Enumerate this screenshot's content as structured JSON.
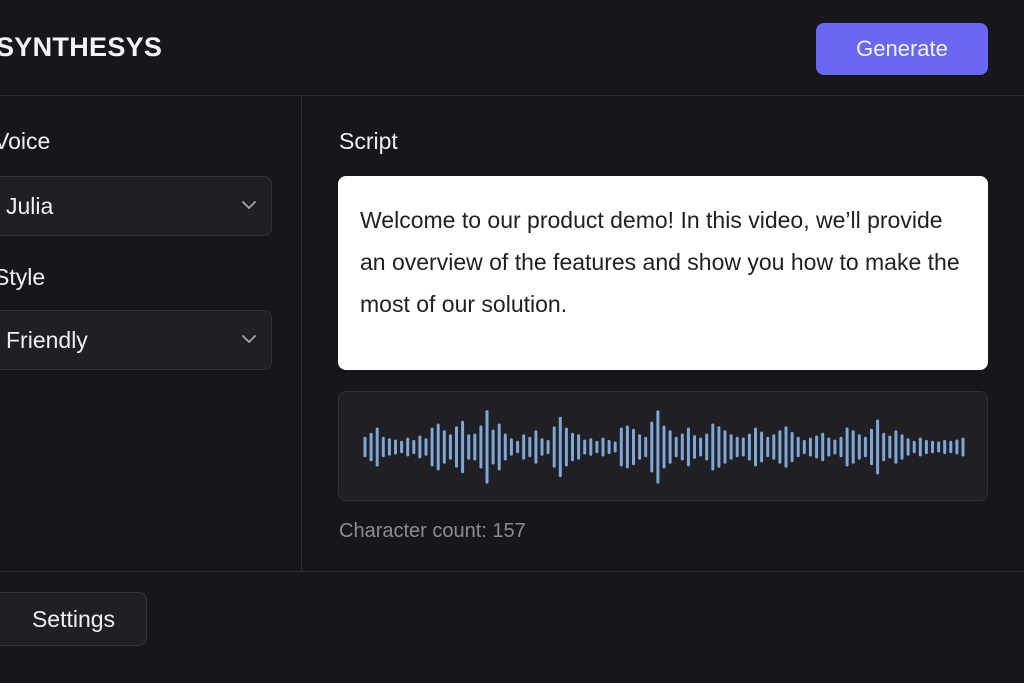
{
  "header": {
    "logo": "SYNTHESYS",
    "generate_label": "Generate",
    "accent_color": "#6a67f0"
  },
  "sidebar": {
    "voice_label": "Voice",
    "voice_value": "Julia",
    "style_label": "Style",
    "style_value": "Friendly",
    "dropdown_icon": "chevron-down-icon"
  },
  "main": {
    "script_label": "Script",
    "script_text": "Welcome to our product demo! In this video, we’ll provide an overview of the features and show you how to make the most of our solution.",
    "character_count": "Character count: 157",
    "waveform_color": "#7ea7d8",
    "waveform_amplitudes": [
      0.22,
      0.32,
      0.45,
      0.22,
      0.18,
      0.15,
      0.12,
      0.2,
      0.14,
      0.25,
      0.18,
      0.45,
      0.55,
      0.38,
      0.28,
      0.48,
      0.62,
      0.28,
      0.3,
      0.5,
      0.88,
      0.4,
      0.55,
      0.3,
      0.18,
      0.12,
      0.28,
      0.22,
      0.38,
      0.18,
      0.14,
      0.48,
      0.72,
      0.45,
      0.32,
      0.28,
      0.15,
      0.18,
      0.12,
      0.2,
      0.14,
      0.1,
      0.45,
      0.5,
      0.42,
      0.28,
      0.22,
      0.6,
      0.88,
      0.5,
      0.38,
      0.22,
      0.3,
      0.45,
      0.26,
      0.2,
      0.3,
      0.55,
      0.48,
      0.38,
      0.28,
      0.22,
      0.2,
      0.3,
      0.45,
      0.35,
      0.22,
      0.28,
      0.38,
      0.48,
      0.34,
      0.22,
      0.14,
      0.2,
      0.25,
      0.32,
      0.2,
      0.15,
      0.22,
      0.45,
      0.38,
      0.28,
      0.22,
      0.42,
      0.65,
      0.32,
      0.25,
      0.38,
      0.28,
      0.18,
      0.12,
      0.2,
      0.14,
      0.12,
      0.1,
      0.14,
      0.12,
      0.15,
      0.2
    ]
  },
  "footer": {
    "settings_label": "Settings"
  }
}
